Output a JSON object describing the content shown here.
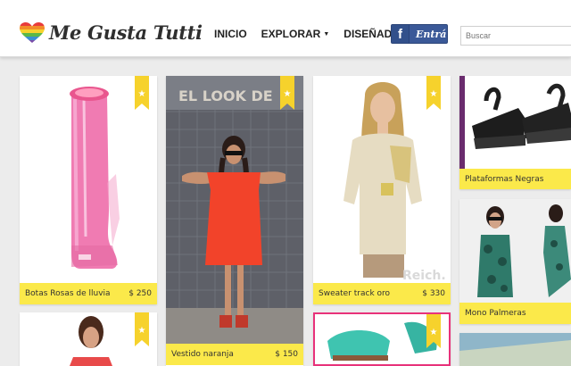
{
  "brand": {
    "name": "Me Gusta Tutti"
  },
  "nav": [
    {
      "label": "INICIO"
    },
    {
      "label": "EXPLORAR",
      "has_dropdown": true
    },
    {
      "label": "DISEÑADORES"
    }
  ],
  "facebook": {
    "label": "Entrá"
  },
  "search": {
    "placeholder": "Buscar"
  },
  "colors": {
    "caption_bg": "#fbe94a",
    "ribbon": "#f6d22c",
    "facebook": "#3b5998"
  },
  "products": [
    {
      "title": "Botas Rosas de lluvia",
      "price": "$ 250"
    },
    {
      "title": "Vestido naranja",
      "price": "$ 150"
    },
    {
      "title": "Sweater track oro",
      "price": "$ 330"
    },
    {
      "title": "Plataformas Negras",
      "price": ""
    },
    {
      "title": "Mono Palmeras",
      "price": ""
    }
  ],
  "photo_text": {
    "wall_sign": "EL LOOK DE",
    "watermark": "Reich."
  }
}
